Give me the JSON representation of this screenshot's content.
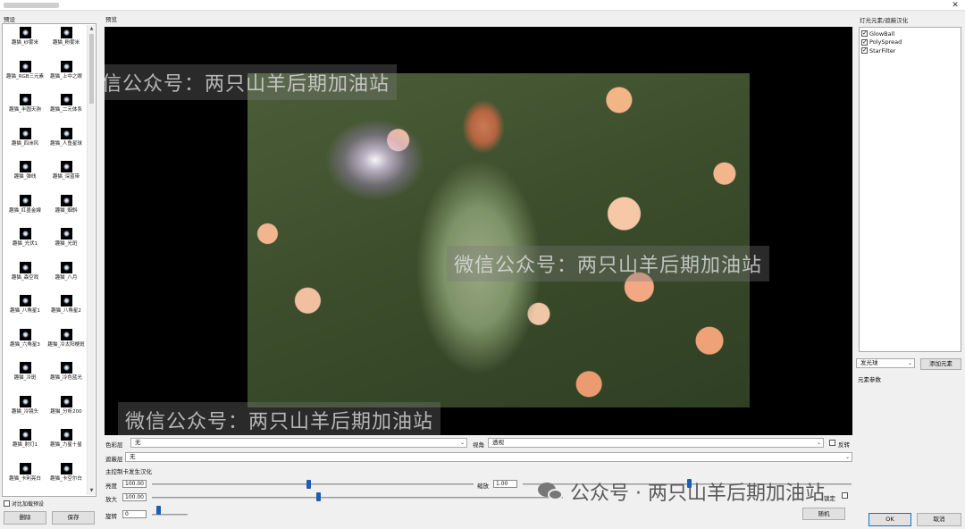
{
  "window": {
    "close_glyph": "✕"
  },
  "presets": {
    "label": "预设",
    "items": [
      {
        "label": "趣猫_纱雾米"
      },
      {
        "label": "趣猫_粉雾米"
      },
      {
        "label": "趣猫_RGB三元素"
      },
      {
        "label": "趣猫_上中之眼"
      },
      {
        "label": "趣猫_半圆天驹"
      },
      {
        "label": "趣猫_二元体系"
      },
      {
        "label": "趣猫_四洲风"
      },
      {
        "label": "趣猫_人鱼星球"
      },
      {
        "label": "趣猫_弹线"
      },
      {
        "label": "趣猫_深蓝带"
      },
      {
        "label": "趣猫_红墨金線"
      },
      {
        "label": "趣猫_烟斜"
      },
      {
        "label": "趣猫_光伏1"
      },
      {
        "label": "趣猫_光斑"
      },
      {
        "label": "趣猫_森空戏"
      },
      {
        "label": "趣猫_八月"
      },
      {
        "label": "趣猫_八角星1"
      },
      {
        "label": "趣猫_八角星2"
      },
      {
        "label": "趣猫_六角星3"
      },
      {
        "label": "趣猫_冷太阳梗斑"
      },
      {
        "label": "趣猫_冷斑"
      },
      {
        "label": "趣猫_冷色蓝光"
      },
      {
        "label": "趣猫_冷镜头"
      },
      {
        "label": "趣猫_分析200"
      },
      {
        "label": "趣猫_射灯1"
      },
      {
        "label": "趣猫_力星十星"
      },
      {
        "label": "趣猫_卡利亮白"
      },
      {
        "label": "趣猫_卡空尔白"
      }
    ],
    "compare_label": "对比加载预设",
    "delete_button": "删除",
    "save_button": "保存"
  },
  "preview": {
    "label": "预览",
    "watermarks": [
      "微信公众号：两只山羊后期加油站",
      "微信公众号：两只山羊后期加油站",
      "微信公众号：两只山羊后期加油站"
    ]
  },
  "controls": {
    "color_label": "色彩层",
    "color_value": "无",
    "view_label": "视角",
    "view_value": "透视",
    "reverse_label": "反转",
    "occlusion_label": "遮蔽层",
    "occlusion_value": "无",
    "section_label": "主控制卡发生汉化",
    "brightness_label": "亮度",
    "brightness_value": "100.00",
    "brightness_level": 0.48,
    "zoom_label": "缩放",
    "zoom_value": "1.00",
    "zoom_level": 0.5,
    "magnify_label": "放大",
    "magnify_value": "100.00",
    "magnify_level": 0.4,
    "rotate_label": "旋转",
    "rotate_value": "0",
    "rotate_level": 0.06,
    "lock_label": "锁定",
    "random_button": "随机"
  },
  "effects": {
    "label": "灯光元素/遮蔽汉化",
    "items": [
      {
        "label": "GlowBall",
        "checked": true
      },
      {
        "label": "PolySpread",
        "checked": true
      },
      {
        "label": "StarFilter",
        "checked": true
      }
    ],
    "type_value": "发光球",
    "add_button": "添加元素",
    "params_label": "元素参数"
  },
  "footer": {
    "ok_button": "OK",
    "cancel_button": "取消",
    "brand_text": "公众号 · 两只山羊后期加油站"
  }
}
